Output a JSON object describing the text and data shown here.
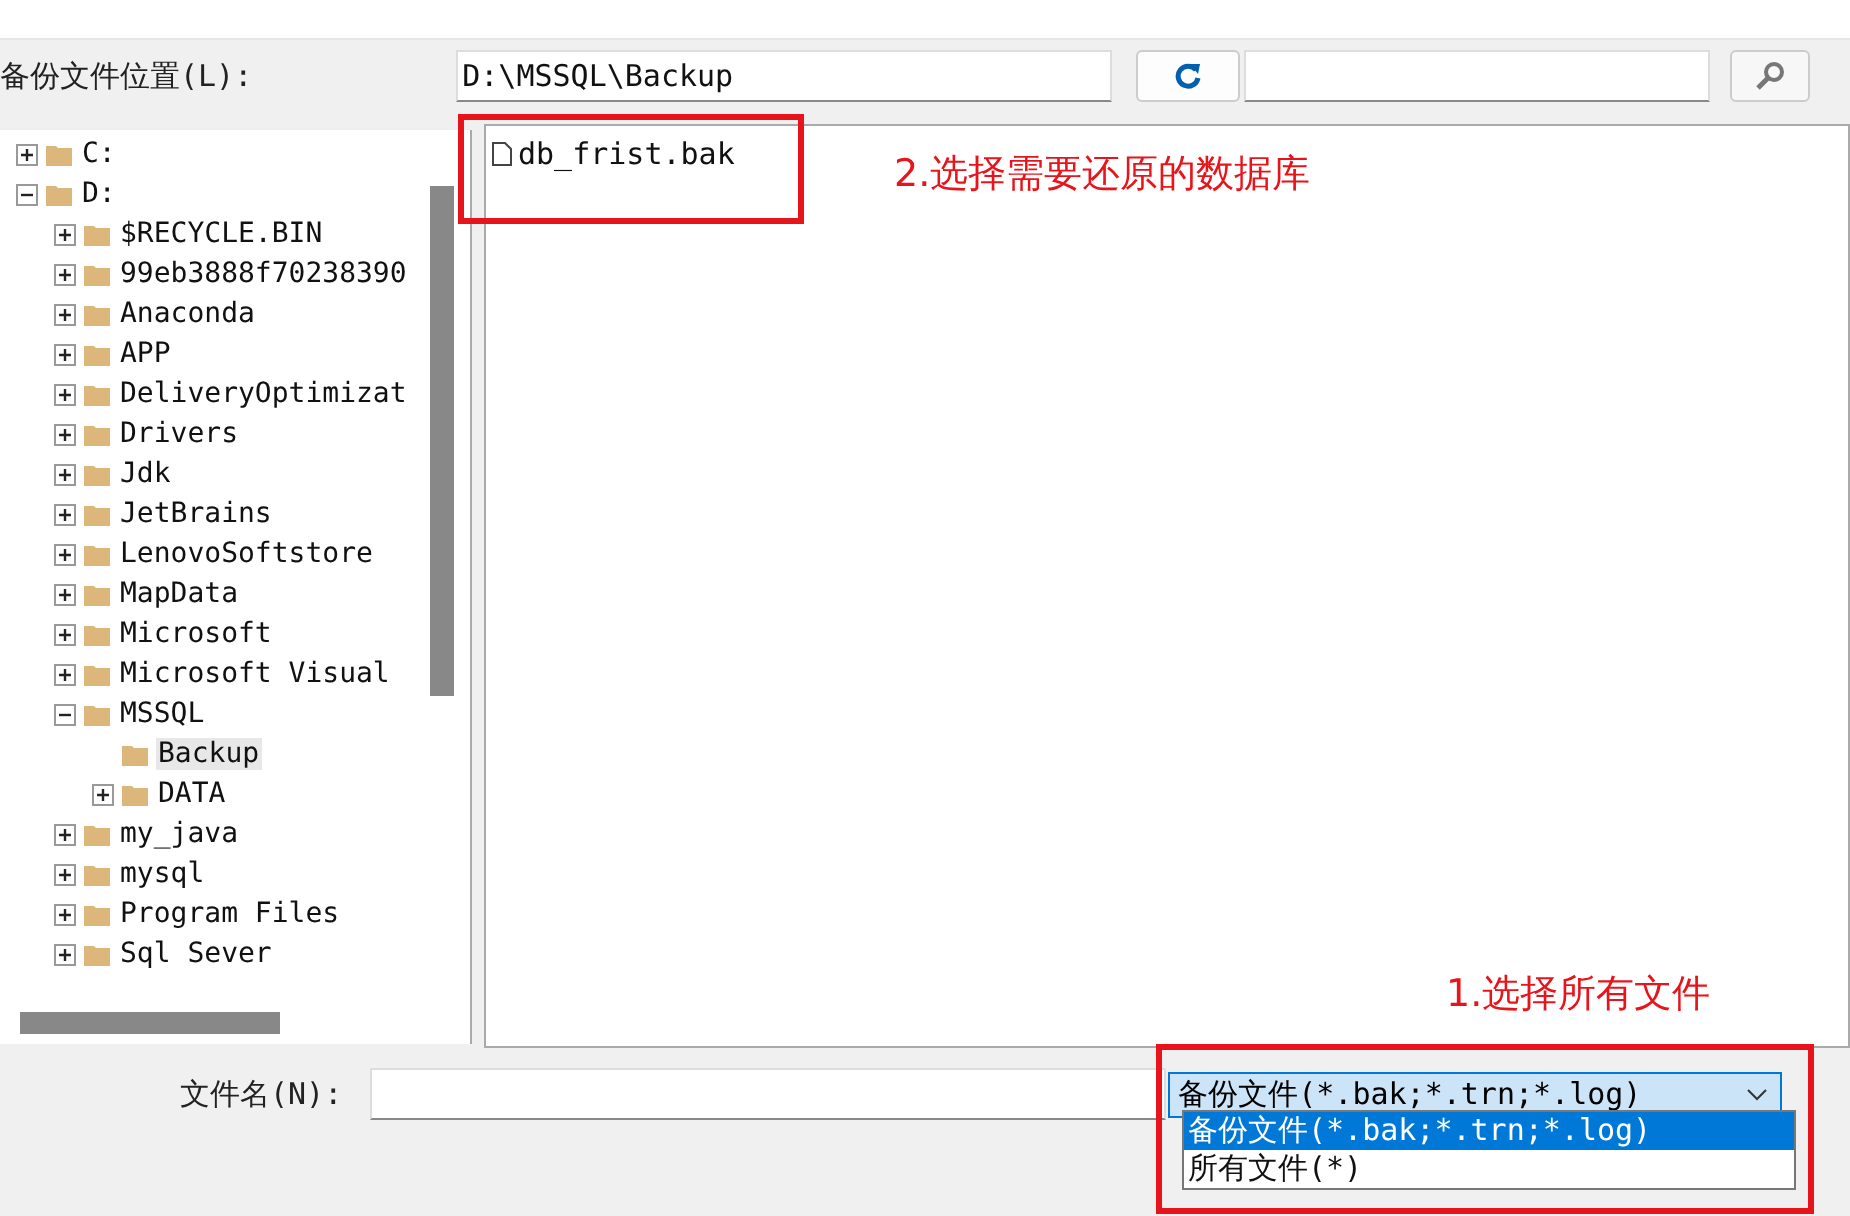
{
  "location": {
    "label": "备份文件位置(L):",
    "path": "D:\\MSSQL\\Backup"
  },
  "tree": [
    {
      "label": "C:",
      "expanded": false,
      "selected": false
    },
    {
      "label": "D:",
      "expanded": true,
      "selected": false,
      "children": [
        {
          "label": "$RECYCLE.BIN",
          "expanded": false,
          "selected": false
        },
        {
          "label": "99eb3888f70238390",
          "expanded": false,
          "selected": false
        },
        {
          "label": "Anaconda",
          "expanded": false,
          "selected": false
        },
        {
          "label": "APP",
          "expanded": false,
          "selected": false
        },
        {
          "label": "DeliveryOptimizat",
          "expanded": false,
          "selected": false
        },
        {
          "label": "Drivers",
          "expanded": false,
          "selected": false
        },
        {
          "label": "Jdk",
          "expanded": false,
          "selected": false
        },
        {
          "label": "JetBrains",
          "expanded": false,
          "selected": false
        },
        {
          "label": "LenovoSoftstore",
          "expanded": false,
          "selected": false
        },
        {
          "label": "MapData",
          "expanded": false,
          "selected": false
        },
        {
          "label": "Microsoft",
          "expanded": false,
          "selected": false
        },
        {
          "label": "Microsoft Visual",
          "expanded": false,
          "selected": false
        },
        {
          "label": "MSSQL",
          "expanded": true,
          "selected": false,
          "children": [
            {
              "label": "Backup",
              "selected": true
            },
            {
              "label": "DATA",
              "expanded": false,
              "selected": false
            }
          ]
        },
        {
          "label": "my_java",
          "expanded": false,
          "selected": false
        },
        {
          "label": "mysql",
          "expanded": false,
          "selected": false
        },
        {
          "label": "Program Files",
          "expanded": false,
          "selected": false
        },
        {
          "label": "Sql Sever",
          "expanded": false,
          "selected": false
        }
      ]
    }
  ],
  "files": [
    {
      "name": "db_frist.bak",
      "selected": false
    }
  ],
  "filename": {
    "label": "文件名(N):"
  },
  "filetype": {
    "value": "备份文件(*.bak;*.trn;*.log)",
    "options": [
      {
        "label": "备份文件(*.bak;*.trn;*.log)",
        "selected": true
      },
      {
        "label": "所有文件(*)",
        "selected": false
      }
    ]
  },
  "annotations": [
    {
      "text": "2.选择需要还原的数据库"
    },
    {
      "text": "1.选择所有文件"
    }
  ]
}
